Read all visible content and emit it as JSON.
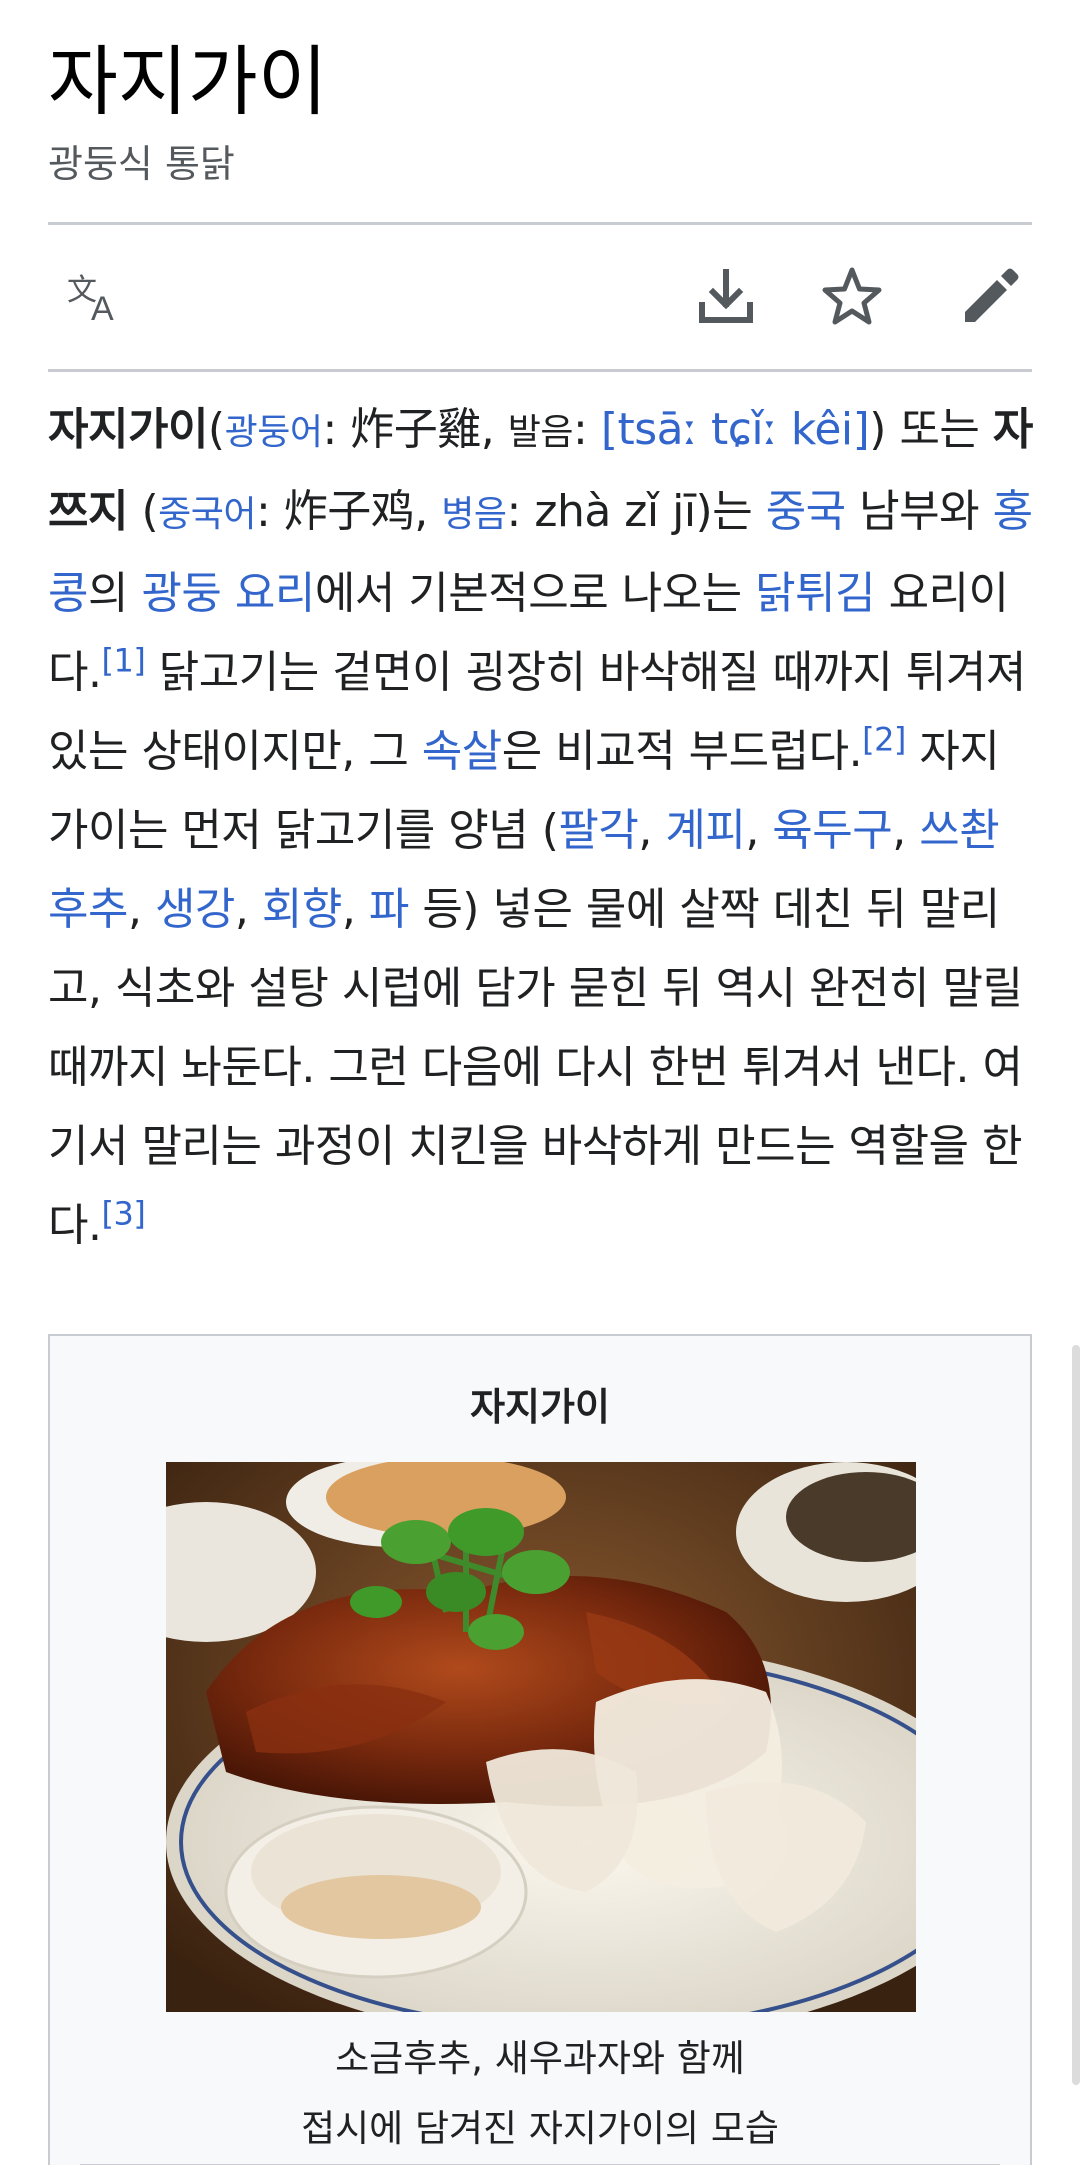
{
  "page": {
    "title": "자지가이",
    "subtitle": "광둥식 통닭"
  },
  "toolbar": {
    "icons": [
      "language-icon",
      "download-icon",
      "star-icon",
      "edit-icon"
    ]
  },
  "article": {
    "bold_name": "자지가이",
    "lang_cantonese": "광둥어",
    "hanzi_traditional": ": 炸子雞, ",
    "pron_label": "발음",
    "pron_colon": ": ",
    "ipa": "[tsāː tɕǐː kêi]",
    "or_text": ") 또는 ",
    "bold_alt": "자쯔지",
    "lang_mandarin": "중국어",
    "hanzi_simplified": ": 炸子鸡, ",
    "pinyin_label": "병음",
    "pinyin_text": ": zhà zǐ jī)는 ",
    "link_china": "중국",
    "t_south": " 남부와 ",
    "link_hongkong": "홍콩",
    "t_of": "의 ",
    "link_cuisine": "광둥 요리",
    "t_basic": "에서 기본적으로 나오는 ",
    "link_friedchicken": "닭튀김",
    "t_dish": " 요리이다.",
    "ref1": "[1]",
    "t_skin": " 닭고기는 겉면이 굉장히 바삭해질 때까지 튀겨져 있는 상태이지만, 그 ",
    "link_flesh": "속살",
    "t_soft": "은 비교적 부드럽다.",
    "ref2": "[2]",
    "t_marinate": " 자지가이는 먼저 닭고기를 양념 (",
    "link_anise": "팔각",
    "comma": ", ",
    "link_cinnamon": "계피",
    "link_nutmeg": "육두구",
    "link_sichuan": "쓰촨 후추",
    "link_ginger": "생강",
    "link_fennel": "회향",
    "link_scallion": "파",
    "t_process": " 등) 넣은 물에 살짝 데친 뒤 말리고, 식초와 설탕 시럽에 담가 묻힌 뒤 역시 완전히 말릴 때까지 놔둔다. 그런 다음에 다시 한번 튀겨서 낸다. 여기서 말리는 과정이 치킨을 바삭하게 만드는 역할을 한다.",
    "ref3": "[3]"
  },
  "infobox": {
    "title": "자지가이",
    "caption_line1": "소금후추, 새우과자와 함께",
    "caption_line2": "접시에 담겨진 자지가이의 모습"
  }
}
